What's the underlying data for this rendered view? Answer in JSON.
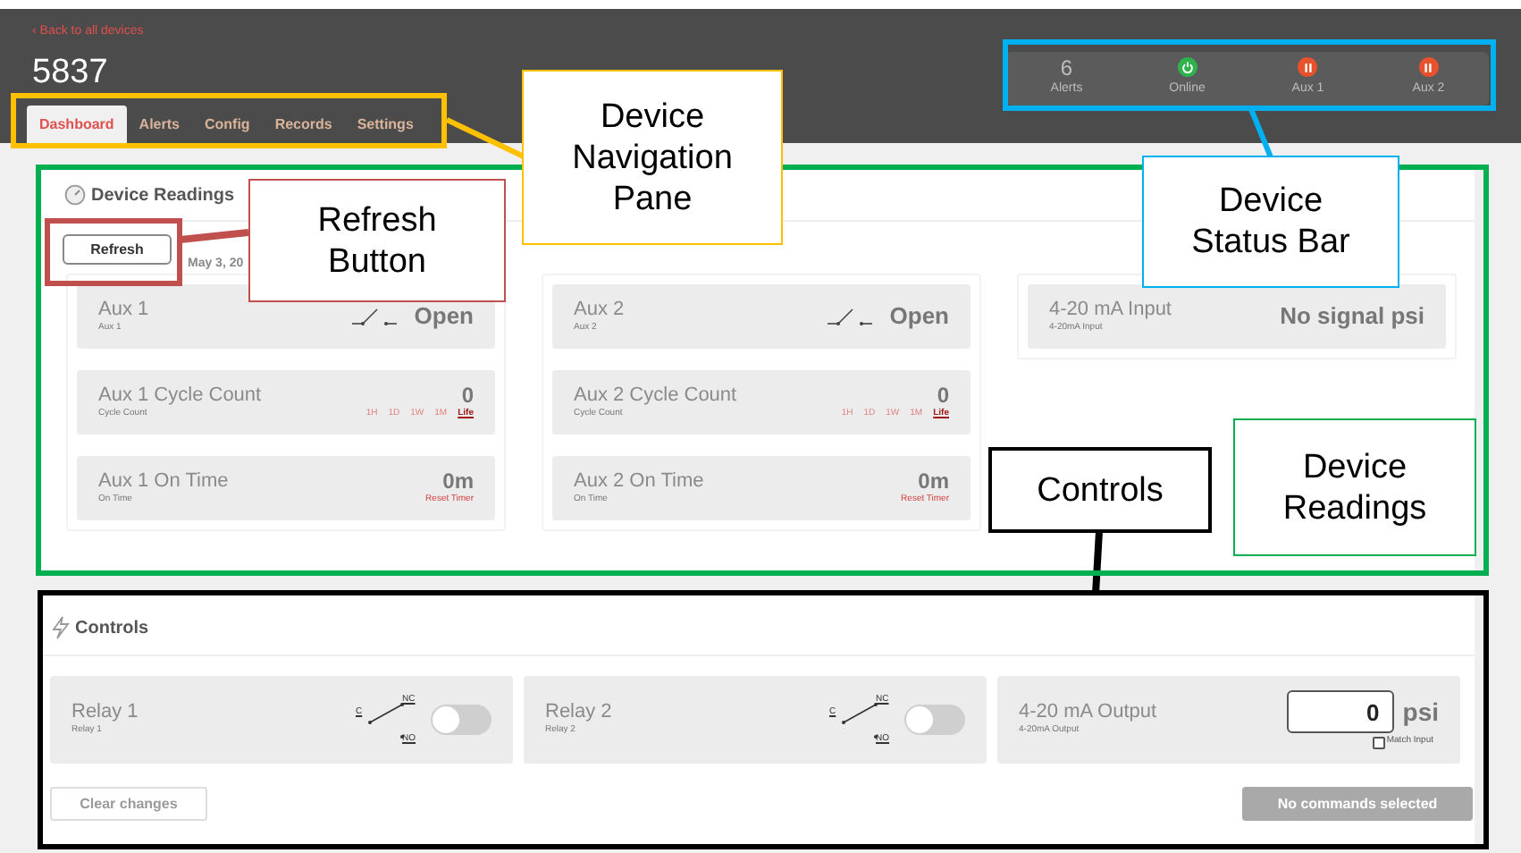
{
  "header": {
    "back_link": "‹ Back to all devices",
    "device_name": "5837",
    "tabs": [
      {
        "label": "Dashboard",
        "selected": true
      },
      {
        "label": "Alerts",
        "selected": false
      },
      {
        "label": "Config",
        "selected": false
      },
      {
        "label": "Records",
        "selected": false
      },
      {
        "label": "Settings",
        "selected": false
      }
    ],
    "status_bar": [
      {
        "kind": "count",
        "value": "6",
        "label": "Alerts"
      },
      {
        "kind": "online",
        "label": "Online",
        "color": "#2db34a"
      },
      {
        "kind": "paused",
        "label": "Aux 1",
        "color": "#e8512d"
      },
      {
        "kind": "paused",
        "label": "Aux 2",
        "color": "#e8512d"
      }
    ]
  },
  "readings": {
    "title": "Device Readings",
    "refresh": "Refresh",
    "date": "May 3, 20",
    "columns": [
      {
        "tiles": [
          {
            "kind": "switch",
            "title": "Aux 1",
            "subtitle": "Aux 1",
            "value": "Open"
          },
          {
            "kind": "count",
            "title": "Aux 1 Cycle Count",
            "subtitle": "Cycle Count",
            "value": "0",
            "ranges": [
              {
                "label": "1H",
                "selected": false
              },
              {
                "label": "1D",
                "selected": false
              },
              {
                "label": "1W",
                "selected": false
              },
              {
                "label": "1M",
                "selected": false
              },
              {
                "label": "Life",
                "selected": true
              }
            ]
          },
          {
            "kind": "timer",
            "title": "Aux 1 On Time",
            "subtitle": "On Time",
            "value": "0m",
            "action": "Reset Timer"
          }
        ]
      },
      {
        "tiles": [
          {
            "kind": "switch",
            "title": "Aux 2",
            "subtitle": "Aux 2",
            "value": "Open"
          },
          {
            "kind": "count",
            "title": "Aux 2 Cycle Count",
            "subtitle": "Cycle Count",
            "value": "0",
            "ranges": [
              {
                "label": "1H",
                "selected": false
              },
              {
                "label": "1D",
                "selected": false
              },
              {
                "label": "1W",
                "selected": false
              },
              {
                "label": "1M",
                "selected": false
              },
              {
                "label": "Life",
                "selected": true
              }
            ]
          },
          {
            "kind": "timer",
            "title": "Aux 2 On Time",
            "subtitle": "On Time",
            "value": "0m",
            "action": "Reset Timer"
          }
        ]
      },
      {
        "tiles": [
          {
            "kind": "input",
            "title": "4-20 mA Input",
            "subtitle": "4-20mA Input",
            "value": "No signal psi"
          }
        ]
      }
    ]
  },
  "controls": {
    "title": "Controls",
    "tiles": [
      {
        "kind": "relay",
        "title": "Relay 1",
        "subtitle": "Relay 1",
        "terminals": [
          "C",
          "NC",
          "NO"
        ],
        "on": false
      },
      {
        "kind": "relay",
        "title": "Relay 2",
        "subtitle": "Relay 2",
        "terminals": [
          "C",
          "NC",
          "NO"
        ],
        "on": false
      },
      {
        "kind": "output",
        "title": "4-20 mA Output",
        "subtitle": "4-20mA Output",
        "value": "0",
        "unit": "psi",
        "checkbox": {
          "label": "Match Input",
          "checked": false
        }
      }
    ],
    "clear_button": {
      "label": "Clear changes",
      "disabled": true
    },
    "send_button": {
      "label": "No commands selected",
      "disabled": true
    }
  },
  "annotations": [
    {
      "text": "Device\nNavigation\nPane",
      "color": "#ffc000"
    },
    {
      "text": "Device\nStatus Bar",
      "color": "#00b0f0"
    },
    {
      "text": "Refresh\nButton",
      "color": "#c0504d"
    },
    {
      "text": "Controls",
      "color": "#000000"
    },
    {
      "text": "Device\nReadings",
      "color": "#00b050"
    }
  ]
}
